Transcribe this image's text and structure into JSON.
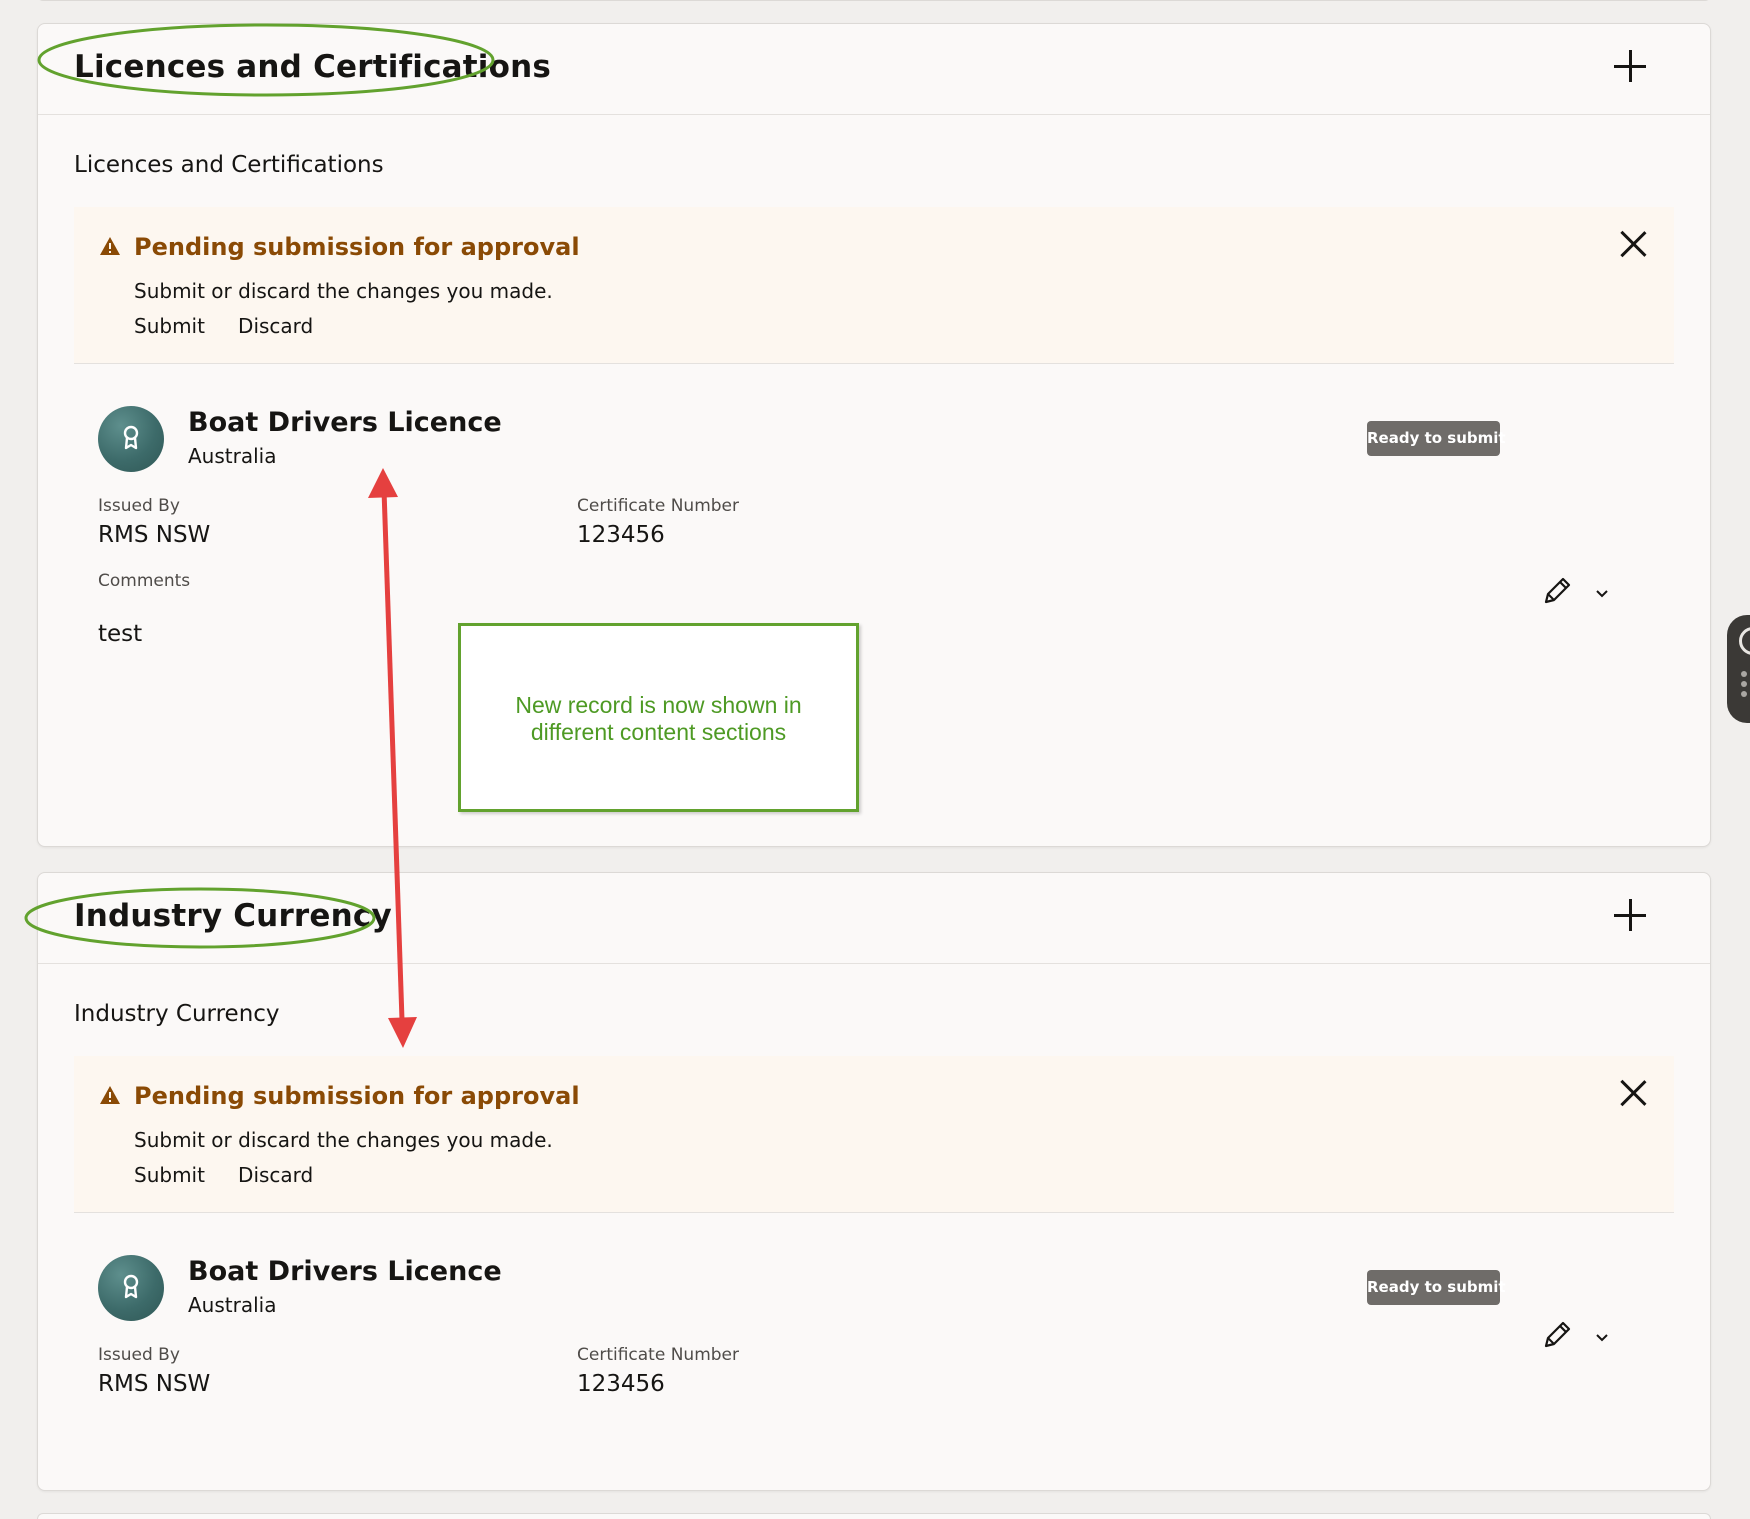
{
  "sections": [
    {
      "header_title": "Licences and Certifications",
      "subtitle": "Licences and Certifications",
      "pending": {
        "title": "Pending submission for approval",
        "message": "Submit or discard the changes you made.",
        "submit_label": "Submit",
        "discard_label": "Discard"
      },
      "record": {
        "title": "Boat Drivers Licence",
        "country": "Australia",
        "status_badge": "Ready to submit",
        "issued_by_label": "Issued By",
        "issued_by_value": "RMS NSW",
        "certificate_number_label": "Certificate Number",
        "certificate_number_value": "123456",
        "comments_label": "Comments",
        "comments_value": "test"
      }
    },
    {
      "header_title": "Industry Currency",
      "subtitle": "Industry Currency",
      "pending": {
        "title": "Pending submission for approval",
        "message": "Submit or discard the changes you made.",
        "submit_label": "Submit",
        "discard_label": "Discard"
      },
      "record": {
        "title": "Boat Drivers Licence",
        "country": "Australia",
        "status_badge": "Ready to submit",
        "issued_by_label": "Issued By",
        "issued_by_value": "RMS NSW",
        "certificate_number_label": "Certificate Number",
        "certificate_number_value": "123456"
      }
    }
  ],
  "annotation": {
    "callout_text": "New record is now shown in different content sections",
    "highlight_color": "#62a22e",
    "arrow_color": "#e5403f"
  },
  "icons": {
    "add": "plus-icon",
    "close": "close-icon",
    "warning": "warning-triangle-icon",
    "avatar": "certificate-ribbon-icon",
    "edit": "pencil-icon",
    "more": "chevron-down-icon"
  },
  "colors": {
    "warning_text": "#8a4a05",
    "badge_bg": "#6f6c69",
    "avatar_bg": "#3d6b6a",
    "pending_bg": "#fdf7f0"
  }
}
